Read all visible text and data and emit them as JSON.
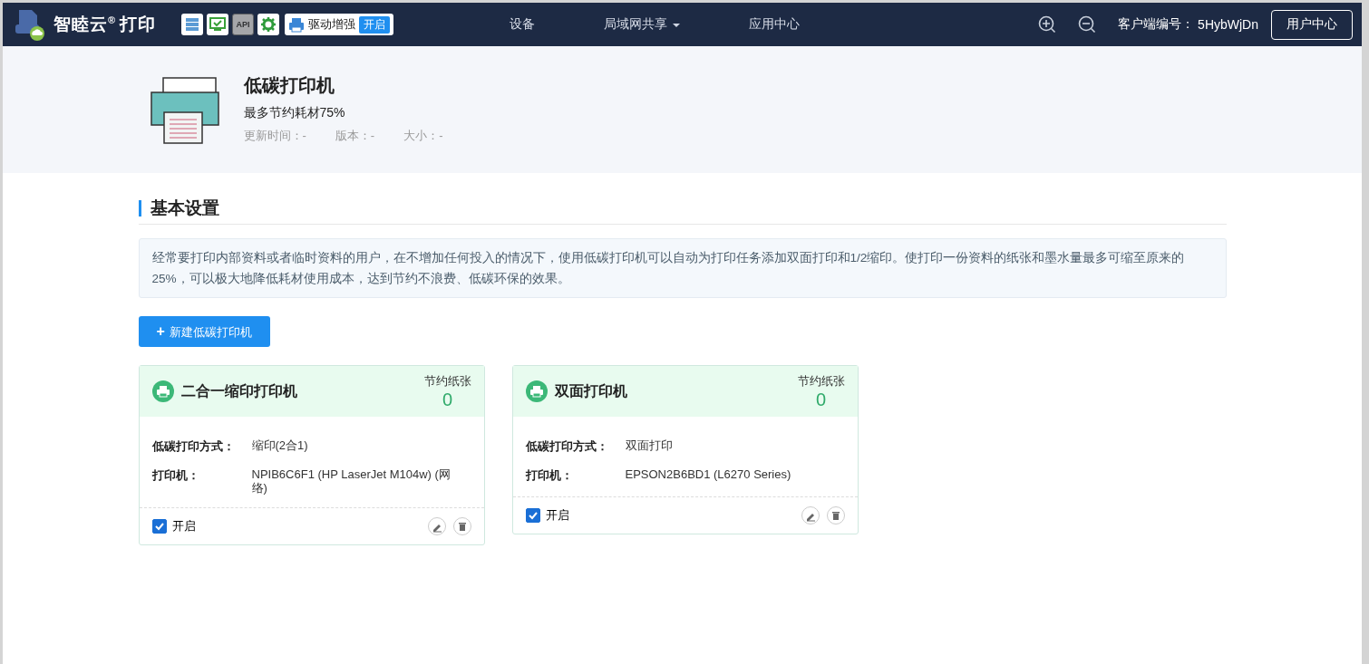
{
  "app": {
    "name": "智睦云",
    "mark": "®",
    "suffix": "打印"
  },
  "toolbar_buttons": [
    {
      "kind": "server",
      "disabled": false
    },
    {
      "kind": "monitor",
      "disabled": false
    },
    {
      "kind": "api",
      "label": "API",
      "disabled": true
    },
    {
      "kind": "gear",
      "disabled": false
    }
  ],
  "driver_enhance": {
    "label": "驱动增强",
    "badge": "开启"
  },
  "nav": [
    {
      "label": "设备",
      "dropdown": false
    },
    {
      "label": "局域网共享",
      "dropdown": true
    },
    {
      "label": "应用中心",
      "dropdown": false
    }
  ],
  "client": {
    "label": "客户端编号：",
    "value": "5HybWjDn"
  },
  "user_center": "用户中心",
  "hero": {
    "title": "低碳打印机",
    "subtitle": "最多节约耗材75%",
    "meta": [
      "更新时间：-",
      "版本：-",
      "大小：-"
    ]
  },
  "section_title": "基本设置",
  "description": "经常要打印内部资料或者临时资料的用户，在不增加任何投入的情况下，使用低碳打印机可以自动为打印任务添加双面打印和1/2缩印。使打印一份资料的纸张和墨水量最多可缩至原来的25%，可以极大地降低耗材使用成本，达到节约不浪费、低碳环保的效果。",
  "new_button": {
    "icon": "+",
    "label": "新建低碳打印机"
  },
  "cards": [
    {
      "title": "二合一缩印打印机",
      "savings_label": "节约纸张",
      "savings_value": "0",
      "fields": [
        {
          "label": "低碳打印方式：",
          "value": "缩印(2合1)"
        },
        {
          "label": "打印机：",
          "value": "NPIB6C6F1 (HP LaserJet M104w) (网络)"
        }
      ],
      "enabled": {
        "label": "开启",
        "checked": true
      }
    },
    {
      "title": "双面打印机",
      "savings_label": "节约纸张",
      "savings_value": "0",
      "fields": [
        {
          "label": "低碳打印方式：",
          "value": "双面打印"
        },
        {
          "label": "打印机：",
          "value": "EPSON2B6BD1 (L6270 Series)"
        }
      ],
      "enabled": {
        "label": "开启",
        "checked": true
      }
    }
  ]
}
